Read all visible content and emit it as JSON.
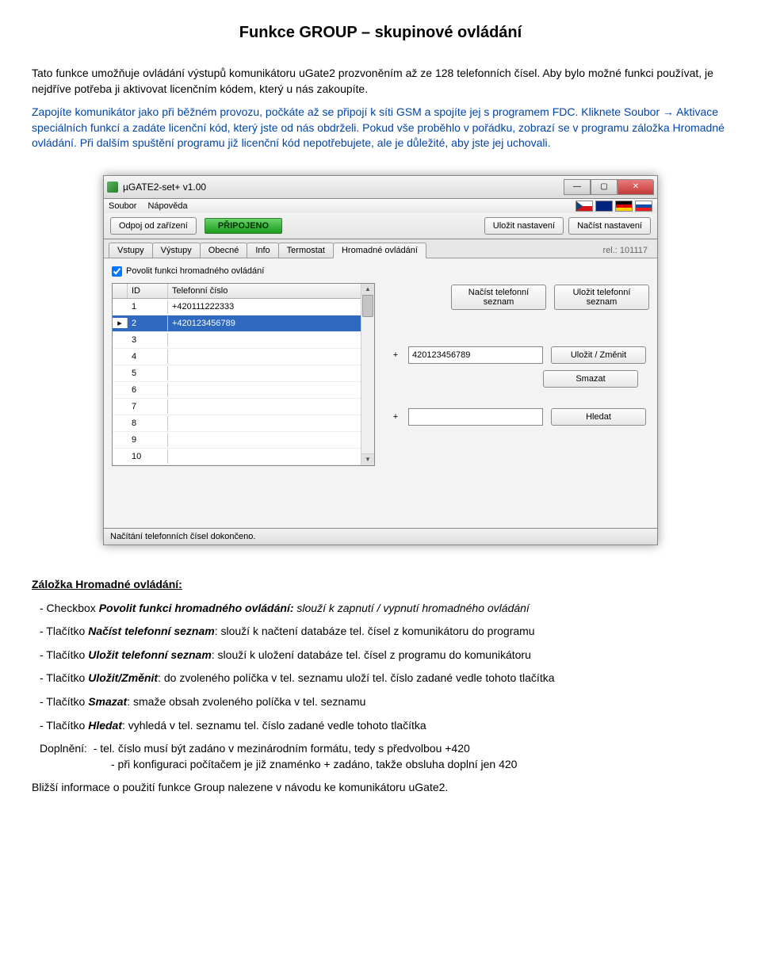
{
  "doc": {
    "title": "Funkce GROUP – skupinové ovládání",
    "p1": "Tato funkce umožňuje ovládání výstupů komunikátoru uGate2 prozvoněním až ze 128 telefonních čísel. Aby bylo možné funkci používat, je nejdříve potřeba ji aktivovat licenčním kódem, který u nás zakoupíte.",
    "p2": "Zapojíte komunikátor jako při běžném provozu, počkáte až se připojí k síti GSM a spojíte jej s programem FDC. Kliknete Soubor → Aktivace speciálních funkcí a zadáte licenční kód, který jste od nás obdrželi. Pokud vše proběhlo v pořádku, zobrazí se v programu záložka Hromadné ovládání. Při dalším spuštění programu již licenční kód nepotřebujete, ale je důležité, aby jste jej uchovali.",
    "section_head": "Záložka Hromadné ovládání:",
    "bullets": {
      "b1_lead": "- Checkbox ",
      "b1_key": "Povolit funkci hromadného ovládání: ",
      "b1_rest": "slouží k zapnutí / vypnutí hromadného ovládání",
      "b2_lead": "- Tlačítko ",
      "b2_key": "Načíst telefonní seznam",
      "b2_rest": ": slouží k načtení databáze tel. čísel z komunikátoru do programu",
      "b3_lead": "- Tlačítko ",
      "b3_key": "Uložit telefonní seznam",
      "b3_rest": ": slouží k uložení databáze tel. čísel z programu do komunikátoru",
      "b4_lead": "- Tlačítko ",
      "b4_key": "Uložit/Změnit",
      "b4_rest": ": do zvoleného políčka v tel. seznamu uloží tel. číslo zadané vedle tohoto tlačítka",
      "b5_lead": "- Tlačítko ",
      "b5_key": "Smazat",
      "b5_rest": ": smaže obsah zvoleného políčka v tel. seznamu",
      "b6_lead": "- Tlačítko ",
      "b6_key": "Hledat",
      "b6_rest": ": vyhledá v tel. seznamu tel. číslo zadané vedle tohoto tlačítka"
    },
    "suppl": {
      "lead": "Doplnění:",
      "l1": "- tel. číslo musí být zadáno v mezinárodním formátu, tedy s předvolbou +420",
      "l2": "- při konfiguraci počítačem je již znaménko + zadáno, takže obsluha doplní jen 420"
    },
    "footer": "Bližší informace o použití funkce Group nalezene v návodu ke komunikátoru uGate2."
  },
  "app": {
    "window_title": "µGATE2-set+ v1.00",
    "menu": {
      "file": "Soubor",
      "help": "Nápověda"
    },
    "toolbar": {
      "disconnect": "Odpoj od zařízení",
      "connected": "PŘIPOJENO",
      "save_settings": "Uložit nastavení",
      "load_settings": "Načíst nastavení"
    },
    "tabs": {
      "items": [
        "Vstupy",
        "Výstupy",
        "Obecné",
        "Info",
        "Termostat",
        "Hromadné ovládání"
      ],
      "rel": "rel.: 101117"
    },
    "check_label": "Povolit funkci hromadného ovládání",
    "table": {
      "head_id": "ID",
      "head_num": "Telefonní číslo",
      "rows": [
        {
          "id": "1",
          "num": "+420111222333"
        },
        {
          "id": "2",
          "num": "+420123456789"
        },
        {
          "id": "3",
          "num": ""
        },
        {
          "id": "4",
          "num": ""
        },
        {
          "id": "5",
          "num": ""
        },
        {
          "id": "6",
          "num": ""
        },
        {
          "id": "7",
          "num": ""
        },
        {
          "id": "8",
          "num": ""
        },
        {
          "id": "9",
          "num": ""
        },
        {
          "id": "10",
          "num": ""
        }
      ],
      "selected_index": 1
    },
    "side": {
      "load_list": "Načíst telefonní\nseznam",
      "save_list": "Uložit telefonní\nseznam",
      "edit_value": "420123456789",
      "save_change": "Uložit / Změnit",
      "delete": "Smazat",
      "search": "Hledat",
      "plus": "+"
    },
    "statusbar": "Načítání telefonních čísel dokončeno."
  }
}
